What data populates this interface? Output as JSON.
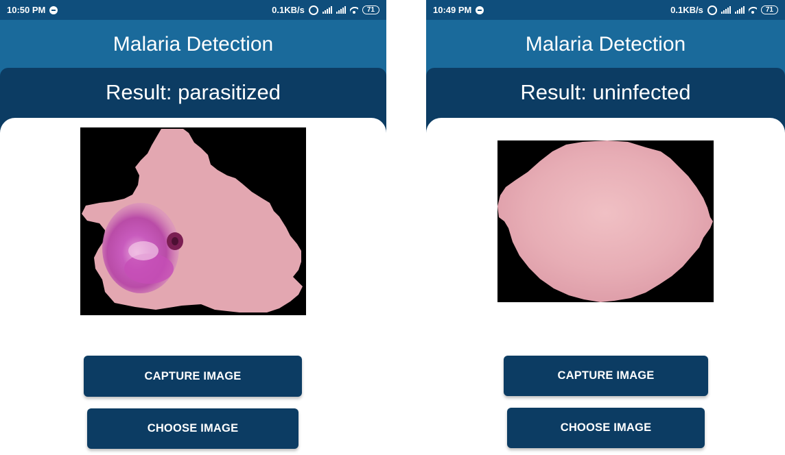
{
  "screens": [
    {
      "status_bar": {
        "time": "10:50 PM",
        "speed": "0.1KB/s",
        "battery": "71",
        "icons": [
          "messenger-icon",
          "alarm-icon",
          "signal-icon",
          "signal-icon",
          "wifi-icon",
          "battery-icon"
        ]
      },
      "app_title": "Malaria Detection",
      "result_label": "Result: parasitized",
      "cell_image": "parasitized-cell",
      "capture_label": "CAPTURE IMAGE",
      "choose_label": "CHOOSE IMAGE"
    },
    {
      "status_bar": {
        "time": "10:49 PM",
        "speed": "0.1KB/s",
        "battery": "71",
        "icons": [
          "messenger-icon",
          "alarm-icon",
          "signal-icon",
          "signal-icon",
          "wifi-icon",
          "battery-icon"
        ]
      },
      "app_title": "Malaria Detection",
      "result_label": "Result: uninfected",
      "cell_image": "uninfected-cell",
      "capture_label": "CAPTURE IMAGE",
      "choose_label": "CHOOSE IMAGE"
    }
  ],
  "colors": {
    "status_bar": "#0f4e7c",
    "app_bar": "#1a6a9b",
    "result_panel": "#0c3c63",
    "button": "#0c3c63",
    "cell_pink": "#e3a7b1",
    "parasite_purple": "#c052b5"
  }
}
